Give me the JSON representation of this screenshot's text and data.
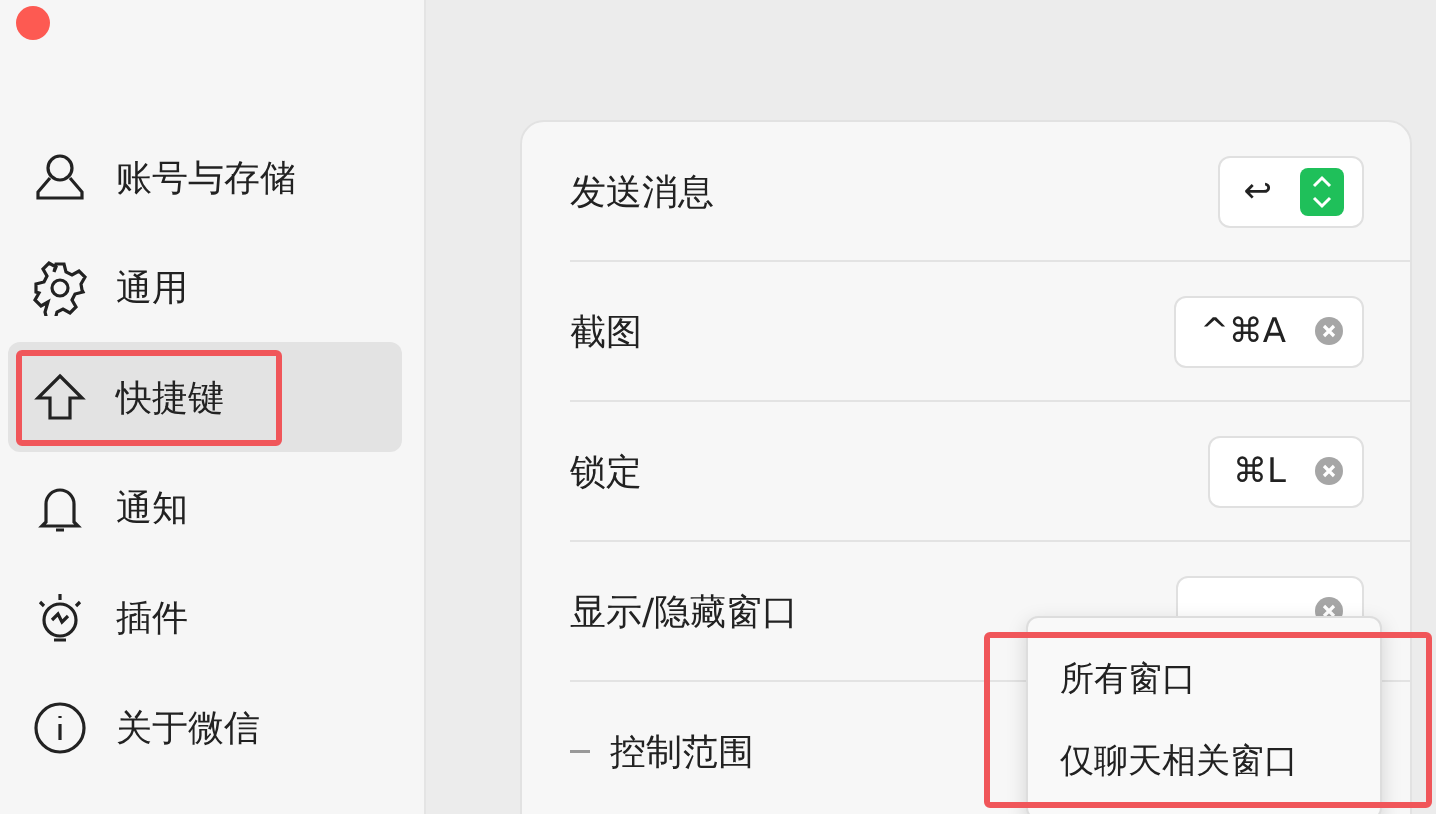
{
  "sidebar": {
    "items": [
      {
        "label": "账号与存储",
        "selected": false,
        "highlighted": false
      },
      {
        "label": "通用",
        "selected": false,
        "highlighted": false
      },
      {
        "label": "快捷键",
        "selected": true,
        "highlighted": true
      },
      {
        "label": "通知",
        "selected": false,
        "highlighted": false
      },
      {
        "label": "插件",
        "selected": false,
        "highlighted": false
      },
      {
        "label": "关于微信",
        "selected": false,
        "highlighted": false
      }
    ]
  },
  "shortcuts": [
    {
      "label": "发送消息",
      "key": "↩",
      "kind": "select"
    },
    {
      "label": "截图",
      "key": "^⌘A",
      "kind": "clearable"
    },
    {
      "label": "锁定",
      "key": "⌘L",
      "kind": "clearable"
    },
    {
      "label": "显示/隐藏窗口",
      "kind": "clearable"
    }
  ],
  "sub_setting": {
    "label": "控制范围"
  },
  "menu": {
    "highlighted": true,
    "items": [
      {
        "label": "所有窗口"
      },
      {
        "label": "仅聊天相关窗口"
      }
    ]
  }
}
